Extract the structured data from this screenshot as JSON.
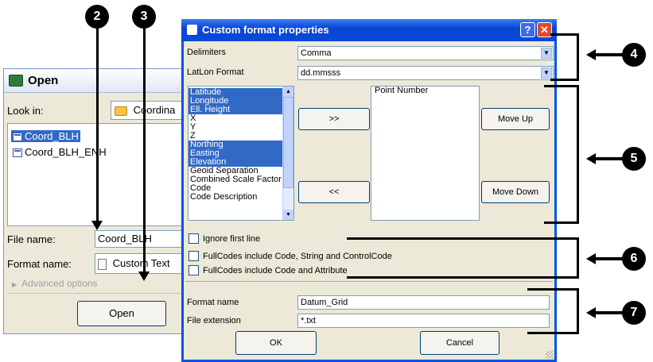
{
  "open_dialog": {
    "title": "Open",
    "look_in_label": "Look in:",
    "look_in_value": "Coordina",
    "files": [
      "Coord_BLH",
      "Coord_BLH_ENH"
    ],
    "file_name_label": "File name:",
    "file_name_value": "Coord_BLH",
    "format_name_label": "Format name:",
    "format_name_value": "Custom Text",
    "advanced_options": "Advanced options",
    "open_button": "Open"
  },
  "custom_format": {
    "title": "Custom format properties",
    "help_btn": "?",
    "close_btn": "✕",
    "delimiters_label": "Delimiters",
    "delimiters_value": "Comma",
    "latlon_label": "LatLon Format",
    "latlon_value": "dd.mmsss",
    "available_fields": [
      {
        "label": "Latitude",
        "selected": true
      },
      {
        "label": "Longitude",
        "selected": true
      },
      {
        "label": "Ell. Height",
        "selected": true
      },
      {
        "label": "X",
        "selected": false
      },
      {
        "label": "Y",
        "selected": false
      },
      {
        "label": "Z",
        "selected": false
      },
      {
        "label": "Northing",
        "selected": true
      },
      {
        "label": "Easting",
        "selected": true
      },
      {
        "label": "Elevation",
        "selected": true
      },
      {
        "label": "Geoid Separation",
        "selected": false
      },
      {
        "label": "Combined Scale Factor",
        "selected": false
      },
      {
        "label": "Code",
        "selected": false
      },
      {
        "label": "Code Description",
        "selected": false
      }
    ],
    "add_btn": ">>",
    "remove_btn": "<<",
    "selected_fields": [
      "Point Number"
    ],
    "move_up": "Move Up",
    "move_down": "Move Down",
    "checkbox_ignore": "Ignore first line",
    "checkbox_fullcodes_1": "FullCodes include Code, String and ControlCode",
    "checkbox_fullcodes_2": "FullCodes include Code and Attribute",
    "format_name_label": "Format name",
    "format_name_value": "Datum_Grid",
    "file_ext_label": "File extension",
    "file_ext_value": "*.txt",
    "ok": "OK",
    "cancel": "Cancel"
  },
  "callouts": [
    "2",
    "3",
    "4",
    "5",
    "6",
    "7"
  ]
}
